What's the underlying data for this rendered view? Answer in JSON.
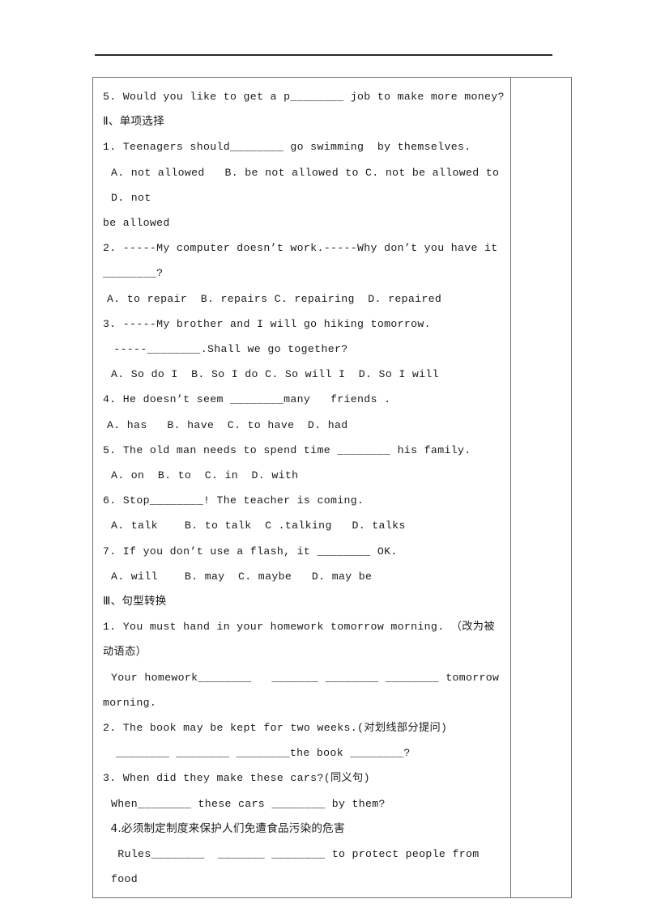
{
  "document": {
    "header_rule": true,
    "notes_column_empty": true,
    "lines": [
      {
        "id": "l1",
        "indent": 0,
        "cn": false,
        "text": "5. Would you like to get a p________ job to make more money?"
      },
      {
        "id": "l2",
        "indent": 0,
        "cn": true,
        "text": "Ⅱ、单项选择"
      },
      {
        "id": "l3",
        "indent": 0,
        "cn": false,
        "text": "1. Teenagers should________ go swimming  by themselves."
      },
      {
        "id": "l4",
        "indent": 1,
        "cn": false,
        "text": "A. not allowed   B. be not allowed to C. not be allowed to D. not"
      },
      {
        "id": "l5",
        "indent": 0,
        "cn": false,
        "text": "be allowed"
      },
      {
        "id": "l6",
        "indent": 0,
        "cn": false,
        "text": "2. -----My computer doesn’t work.-----Why don’t you have it"
      },
      {
        "id": "l7",
        "indent": 0,
        "cn": false,
        "text": "________?"
      },
      {
        "id": "l8",
        "indent": 2,
        "cn": false,
        "text": "A. to repair  B. repairs C. repairing  D. repaired"
      },
      {
        "id": "l9",
        "indent": 0,
        "cn": false,
        "text": "3. -----My brother and I will go hiking tomorrow."
      },
      {
        "id": "l10",
        "indent": 2,
        "cn": false,
        "text": " -----________.Shall we go together?"
      },
      {
        "id": "l11",
        "indent": 1,
        "cn": false,
        "text": "A. So do I  B. So I do C. So will I  D. So I will"
      },
      {
        "id": "l12",
        "indent": 0,
        "cn": false,
        "text": "4. He doesn’t seem ________many   friends ."
      },
      {
        "id": "l13",
        "indent": 2,
        "cn": false,
        "text": "A. has   B. have  C. to have  D. had"
      },
      {
        "id": "l14",
        "indent": 0,
        "cn": false,
        "text": "5. The old man needs to spend time ________ his family."
      },
      {
        "id": "l15",
        "indent": 1,
        "cn": false,
        "text": "A. on  B. to  C. in  D. with"
      },
      {
        "id": "l16",
        "indent": 0,
        "cn": false,
        "text": "6. Stop________! The teacher is coming."
      },
      {
        "id": "l17",
        "indent": 1,
        "cn": false,
        "text": "A. talk    B. to talk  C .talking   D. talks"
      },
      {
        "id": "l18",
        "indent": 0,
        "cn": false,
        "text": "7. If you don’t use a flash, it ________ OK."
      },
      {
        "id": "l19",
        "indent": 1,
        "cn": false,
        "text": "A. will    B. may  C. maybe   D. may be"
      },
      {
        "id": "l20",
        "indent": 0,
        "cn": true,
        "text": "Ⅲ、句型转换"
      },
      {
        "id": "l21",
        "indent": 0,
        "cn": false,
        "text": "1. You must hand in your homework tomorrow morning. （改为被动语态）"
      },
      {
        "id": "l22",
        "indent": 1,
        "cn": false,
        "text": "Your homework________   _______ ________ ________ tomorrow"
      },
      {
        "id": "l23",
        "indent": 0,
        "cn": false,
        "text": "morning."
      },
      {
        "id": "l24",
        "indent": 0,
        "cn": false,
        "text": "2. The book may be kept for two weeks.(对划线部分提问)"
      },
      {
        "id": "l25",
        "indent": 3,
        "cn": false,
        "text": "________ ________ ________the book ________?"
      },
      {
        "id": "l26",
        "indent": 0,
        "cn": false,
        "text": "3. When did they make these cars?(同义句)"
      },
      {
        "id": "l27",
        "indent": 1,
        "cn": false,
        "text": "When________ these cars ________ by them?"
      },
      {
        "id": "l28",
        "indent": 2,
        "cn": true,
        "text": " 4.必须制定制度来保护人们免遭食品污染的危害"
      },
      {
        "id": "l29",
        "indent": 1,
        "cn": false,
        "text": " Rules________  _______ ________ to protect people from food"
      }
    ]
  }
}
